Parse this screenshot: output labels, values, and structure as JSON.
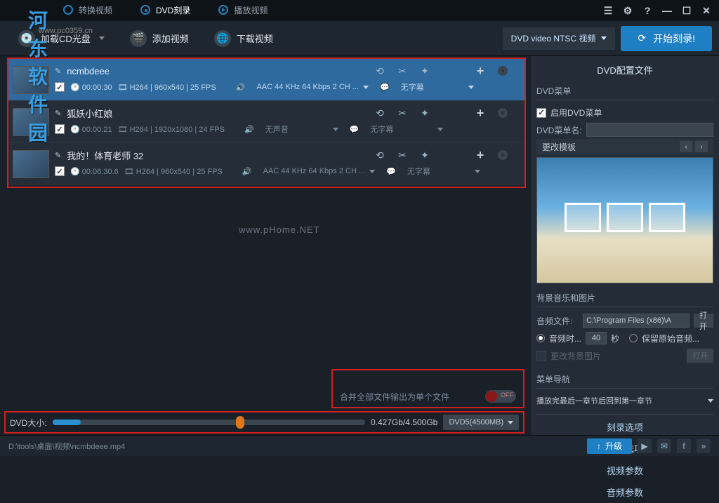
{
  "tabs": {
    "convert": "转换视频",
    "dvd": "DVD刻录",
    "play": "播放视频"
  },
  "logo": {
    "main": "河东软件园",
    "sub": "www.pc0359.cn"
  },
  "toolbar": {
    "load_cd": "加载CD光盘",
    "add_video": "添加视频",
    "download": "下载视频",
    "format": "DVD video NTSC 视频",
    "burn": "开始刻录!"
  },
  "videos": [
    {
      "title": "ncmbdeee",
      "duration": "00:00:30",
      "video_info": "H264 | 960x540 | 25 FPS",
      "audio": "AAC 44 KHz 64 Kbps 2 CH ...",
      "subtitle": "无字幕",
      "selected": true
    },
    {
      "title": "狐妖小红娘",
      "duration": "00:00:21",
      "video_info": "H264 | 1920x1080 | 24 FPS",
      "audio": "无声音",
      "subtitle": "无字幕",
      "selected": false
    },
    {
      "title": "我的！体育老师 32",
      "duration": "00:06:30.6",
      "video_info": "H264 | 960x540 | 25 FPS",
      "audio": "AAC 44 KHz 64 Kbps 2 CH ...",
      "subtitle": "无字幕",
      "selected": false
    }
  ],
  "watermark": "www.pHome.NET",
  "merge": {
    "label": "合并全部文件输出为单个文件",
    "state": "OFF"
  },
  "dvd_size": {
    "label": "DVD大小:",
    "text": "0.427Gb/4.500Gb",
    "preset": "DVD5(4500MB)"
  },
  "right": {
    "title": "DVD配置文件",
    "menu_section": "DVD菜单",
    "enable_menu": "启用DVD菜单",
    "menu_name_label": "DVD菜单名:",
    "menu_name_value": "",
    "change_template": "更改模板",
    "bg_section": "背景音乐和图片",
    "audio_file_label": "音频文件:",
    "audio_file_value": "C:\\Program Files (x86)\\A",
    "open": "打开",
    "audio_time": "音频时...",
    "audio_seconds": "40",
    "seconds_unit": "秒",
    "keep_original": "保留原始音频...",
    "change_bg": "更改背景图片",
    "nav_section": "菜单导航",
    "nav_behavior": "播放完最后一章节后回到第一章节",
    "options": {
      "burn": "刻录选项",
      "basic": "基本选项",
      "video": "视频参数",
      "audio": "音频参数"
    }
  },
  "status": {
    "path": "D:\\tools\\桌面\\视频\\ncmbdeee.mp4",
    "upgrade": "升级"
  }
}
